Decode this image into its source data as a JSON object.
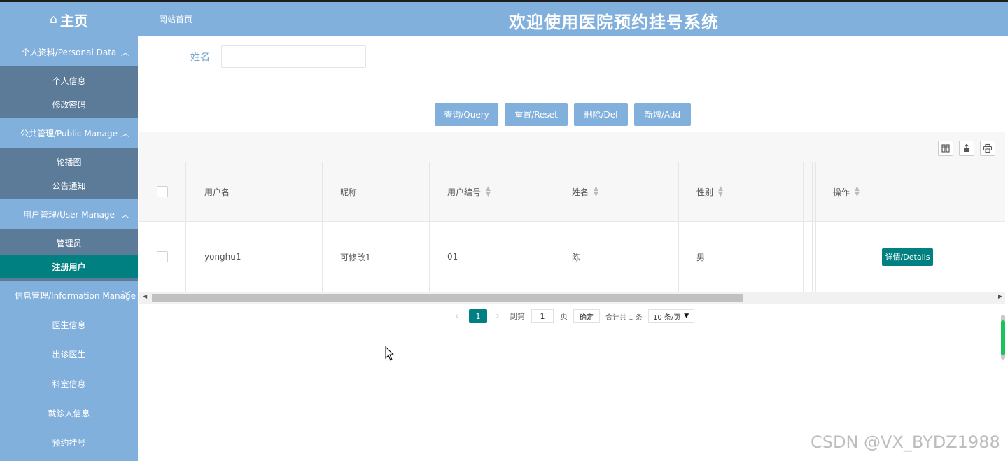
{
  "sidebar": {
    "logo": "主页",
    "groups": [
      {
        "label": "个人资料/Personal Data",
        "items": [
          "个人信息",
          "修改密码"
        ]
      },
      {
        "label": "公共管理/Public Manage",
        "items": [
          "轮播图",
          "公告通知"
        ]
      },
      {
        "label": "用户管理/User Manage",
        "items": [
          "管理员",
          "注册用户"
        ]
      },
      {
        "label": "信息管理/Information Manage",
        "items": [
          "医生信息",
          "出诊医生",
          "科室信息",
          "就诊人信息",
          "预约挂号"
        ]
      }
    ],
    "active_item": "注册用户"
  },
  "header": {
    "breadcrumb": "网站首页",
    "title": "欢迎使用医院预约挂号系统"
  },
  "search": {
    "label": "姓名",
    "value": ""
  },
  "buttons": {
    "query": "查询/Query",
    "reset": "重置/Reset",
    "delete": "删除/Del",
    "add": "新增/Add"
  },
  "table": {
    "columns": [
      "用户名",
      "昵称",
      "用户编号",
      "姓名",
      "性别",
      "操作"
    ],
    "rows": [
      {
        "username": "yonghu1",
        "nickname": "可修改1",
        "user_no": "01",
        "name": "陈",
        "gender": "男",
        "action": "详情/Details"
      }
    ]
  },
  "pager": {
    "current": "1",
    "goto_label": "到第",
    "page_value": "1",
    "page_unit": "页",
    "confirm": "确定",
    "total": "合计共 1 条",
    "per_page": "10 条/页"
  },
  "watermark": "CSDN @VX_BYDZ1988",
  "colors": {
    "sidebar": "#82b0dc",
    "submenu": "#5b7b99",
    "accent": "#008080"
  }
}
